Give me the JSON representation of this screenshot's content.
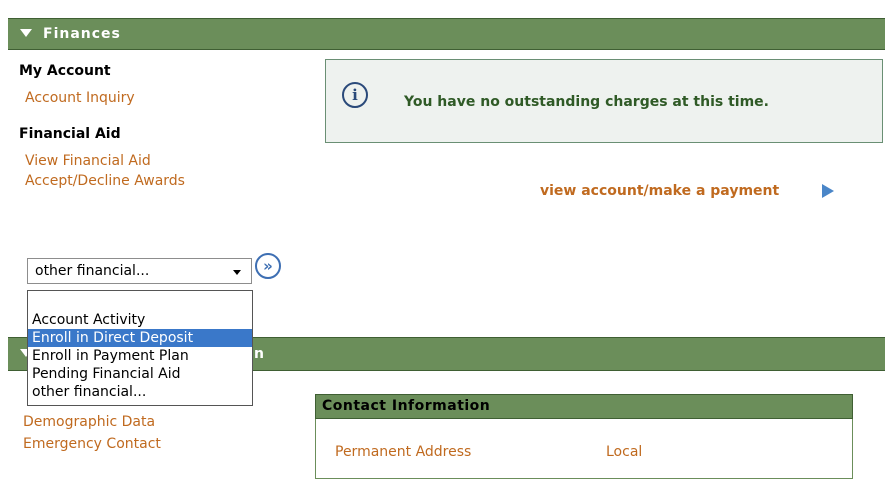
{
  "finances": {
    "title": "Finances",
    "my_account": {
      "heading": "My Account",
      "links": [
        "Account Inquiry"
      ]
    },
    "financial_aid": {
      "heading": "Financial Aid",
      "links": [
        "View Financial Aid",
        "Accept/Decline Awards"
      ]
    },
    "notice": {
      "icon": "info-icon",
      "text": "You have no outstanding charges at this time."
    },
    "payment_link": "view account/make a payment",
    "select": {
      "value": "other financial...",
      "go_symbol": "»",
      "options": [
        "Account Activity",
        "Enroll in Direct Deposit",
        "Enroll in Payment Plan",
        "Pending Financial Aid",
        "other financial..."
      ],
      "highlighted_option": "Enroll in Direct Deposit"
    }
  },
  "personal": {
    "title_visible": "n",
    "links": [
      "Demographic Data",
      "Emergency Contact"
    ],
    "contact_info": {
      "title": "Contact Information",
      "labels": [
        "Permanent Address",
        "Local"
      ]
    }
  },
  "colors": {
    "section_bar": "#6b8e5a",
    "link": "#c06a1f",
    "selection": "#3a78c9",
    "notice_text": "#2f5a26"
  }
}
